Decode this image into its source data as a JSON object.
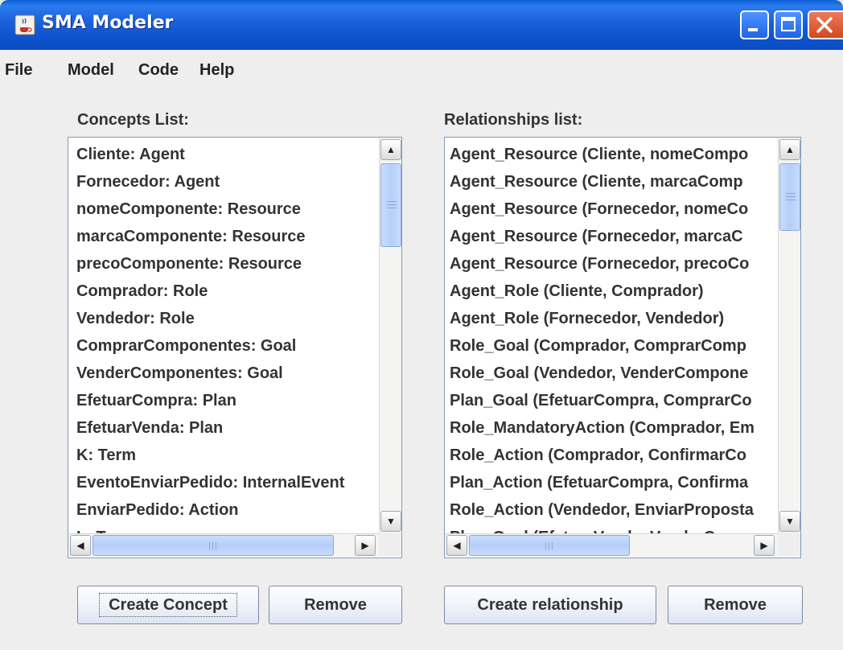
{
  "window": {
    "title": "SMA Modeler",
    "controls": {
      "minimize": "minimize",
      "maximize": "maximize",
      "close": "close"
    }
  },
  "menu": [
    "File",
    "Model",
    "Code",
    "Help"
  ],
  "concepts": {
    "label": "Concepts List:",
    "items": [
      "Cliente: Agent",
      "Fornecedor: Agent",
      "nomeComponente: Resource",
      "marcaComponente: Resource",
      "precoComponente: Resource",
      "Comprador: Role",
      "Vendedor: Role",
      "ComprarComponentes: Goal",
      "VenderComponentes: Goal",
      "EfetuarCompra: Plan",
      "EfetuarVenda: Plan",
      "K: Term",
      "EventoEnviarPedido: InternalEvent",
      "EnviarPedido: Action",
      "L: Term"
    ],
    "create_button": "Create Concept",
    "remove_button": "Remove"
  },
  "relationships": {
    "label": "Relationships list:",
    "items": [
      "Agent_Resource (Cliente, nomeCompo",
      "Agent_Resource (Cliente, marcaComp",
      "Agent_Resource (Fornecedor, nomeCo",
      "Agent_Resource (Fornecedor, marcaC",
      "Agent_Resource (Fornecedor, precoCo",
      "Agent_Role (Cliente, Comprador)",
      "Agent_Role (Fornecedor, Vendedor)",
      "Role_Goal (Comprador, ComprarComp",
      "Role_Goal (Vendedor, VenderCompone",
      "Plan_Goal (EfetuarCompra, ComprarCo",
      "Role_MandatoryAction (Comprador, Em",
      "Role_Action (Comprador, ConfirmarCo",
      "Plan_Action (EfetuarCompra, Confirma",
      "Role_Action (Vendedor, EnviarProposta",
      "Plan_Goal (EfetuarVenda, VenderComp"
    ],
    "create_button": "Create relationship",
    "remove_button": "Remove"
  },
  "colors": {
    "titlebar": "#0b4cc2",
    "panel": "#eeeeee",
    "list_border": "#7f9db9",
    "scroll_thumb": "#c8dcff",
    "close_button": "#d4481d"
  },
  "icons": {
    "app": "java-coffee-cup-icon",
    "scroll_up": "arrow-up-icon",
    "scroll_down": "arrow-down-icon",
    "scroll_left": "arrow-left-icon",
    "scroll_right": "arrow-right-icon"
  }
}
